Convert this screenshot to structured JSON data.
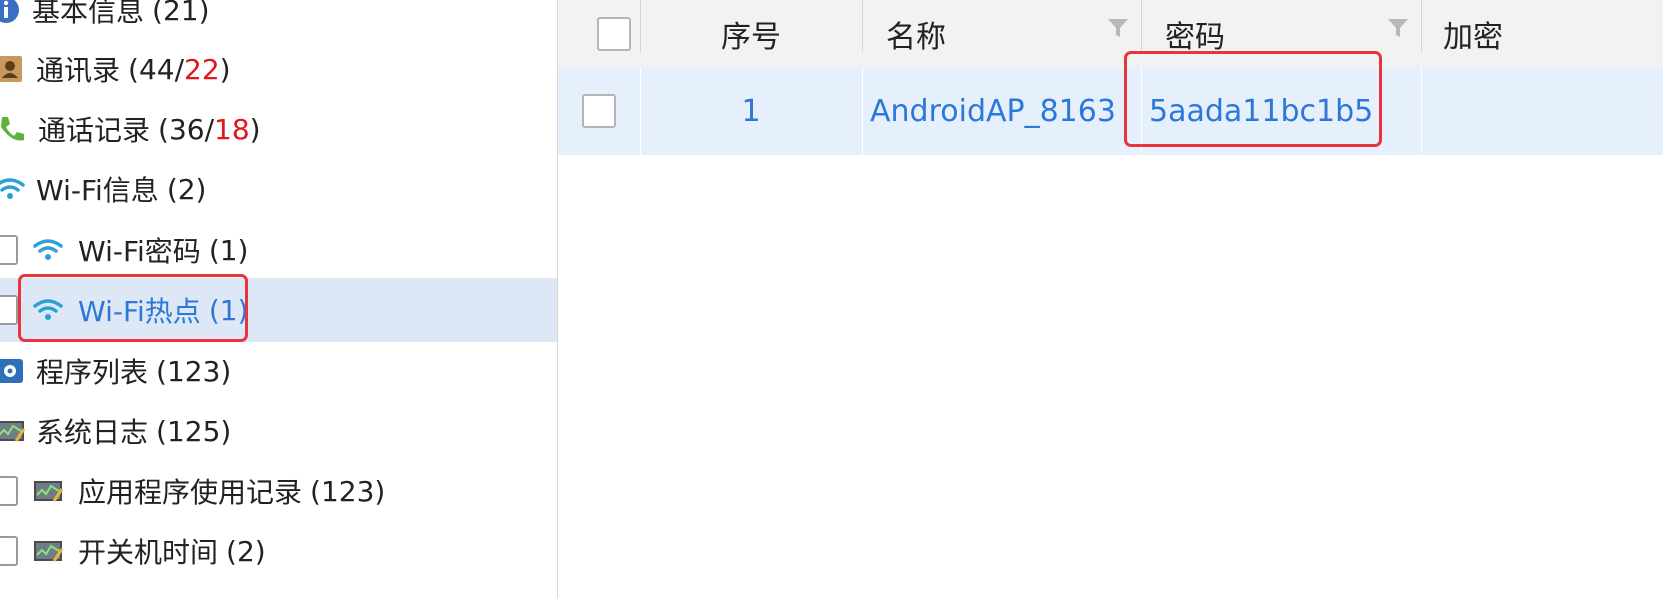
{
  "sidebar": {
    "items": [
      {
        "label": "基本信息",
        "count_open": " (21)",
        "count_red": "",
        "count_close": ""
      },
      {
        "label": "通讯录",
        "count_open": " (44/",
        "count_red": "22",
        "count_close": ")"
      },
      {
        "label": "通话记录",
        "count_open": " (36/",
        "count_red": "18",
        "count_close": ")"
      },
      {
        "label": "Wi-Fi信息",
        "count_open": " (2)",
        "count_red": "",
        "count_close": ""
      },
      {
        "label": "Wi-Fi密码",
        "count_open": " (1)",
        "count_red": "",
        "count_close": ""
      },
      {
        "label": "Wi-Fi热点",
        "count_open": " (1)",
        "count_red": "",
        "count_close": ""
      },
      {
        "label": "程序列表",
        "count_open": " (123)",
        "count_red": "",
        "count_close": ""
      },
      {
        "label": "系统日志",
        "count_open": " (125)",
        "count_red": "",
        "count_close": ""
      },
      {
        "label": "应用程序使用记录",
        "count_open": " (123)",
        "count_red": "",
        "count_close": ""
      },
      {
        "label": "开关机时间",
        "count_open": " (2)",
        "count_red": "",
        "count_close": ""
      }
    ],
    "selected_index": 5
  },
  "grid": {
    "columns": [
      "序号",
      "名称",
      "密码",
      "加密"
    ],
    "rows": [
      {
        "index": "1",
        "name": "AndroidAP_8163",
        "password": "5aada11bc1b5",
        "encryption": ""
      }
    ]
  },
  "colors": {
    "selected_text": "#2b78d8",
    "selected_row_bg": "#e6f0fd",
    "count_highlight": "#e3141a",
    "annotation": "#e8343b"
  }
}
